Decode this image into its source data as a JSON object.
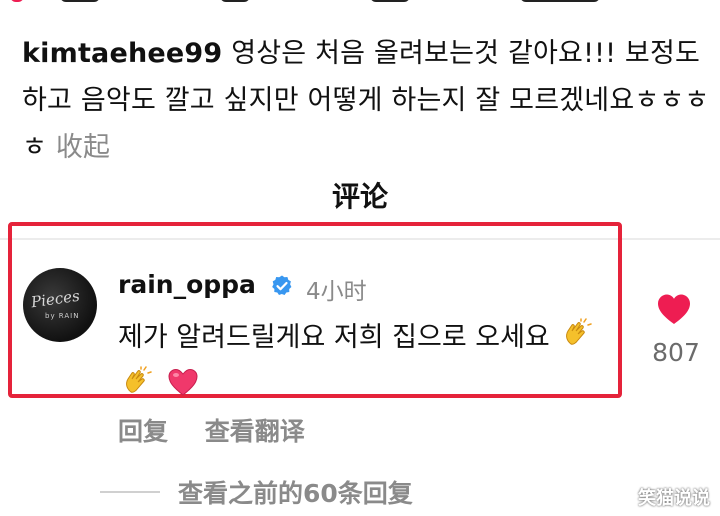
{
  "caption": {
    "username": "kimtaehee99",
    "text": "영상은 처음 올려보는것 같아요!!! 보정도 하고 음악도 깔고 싶지만 어떻게 하는지 잘 모르겠네요ㅎㅎㅎㅎ",
    "collapse_label": "收起"
  },
  "section_title": "评论",
  "comment": {
    "username": "rain_oppa",
    "time": "4小时",
    "text": "제가 알려드릴게요 저희 집으로 오세요",
    "avatar_script": "Pieces",
    "avatar_sub": "by RAIN",
    "like_count": "807"
  },
  "actions": {
    "reply": "回复",
    "translate": "查看翻译"
  },
  "more_replies": "查看之前的60条回复",
  "watermark": "笑猫说说",
  "colors": {
    "highlight": "#e5233a",
    "heart": "#ee1d52",
    "verified": "#3897f0",
    "muted": "#8a8a8a"
  }
}
